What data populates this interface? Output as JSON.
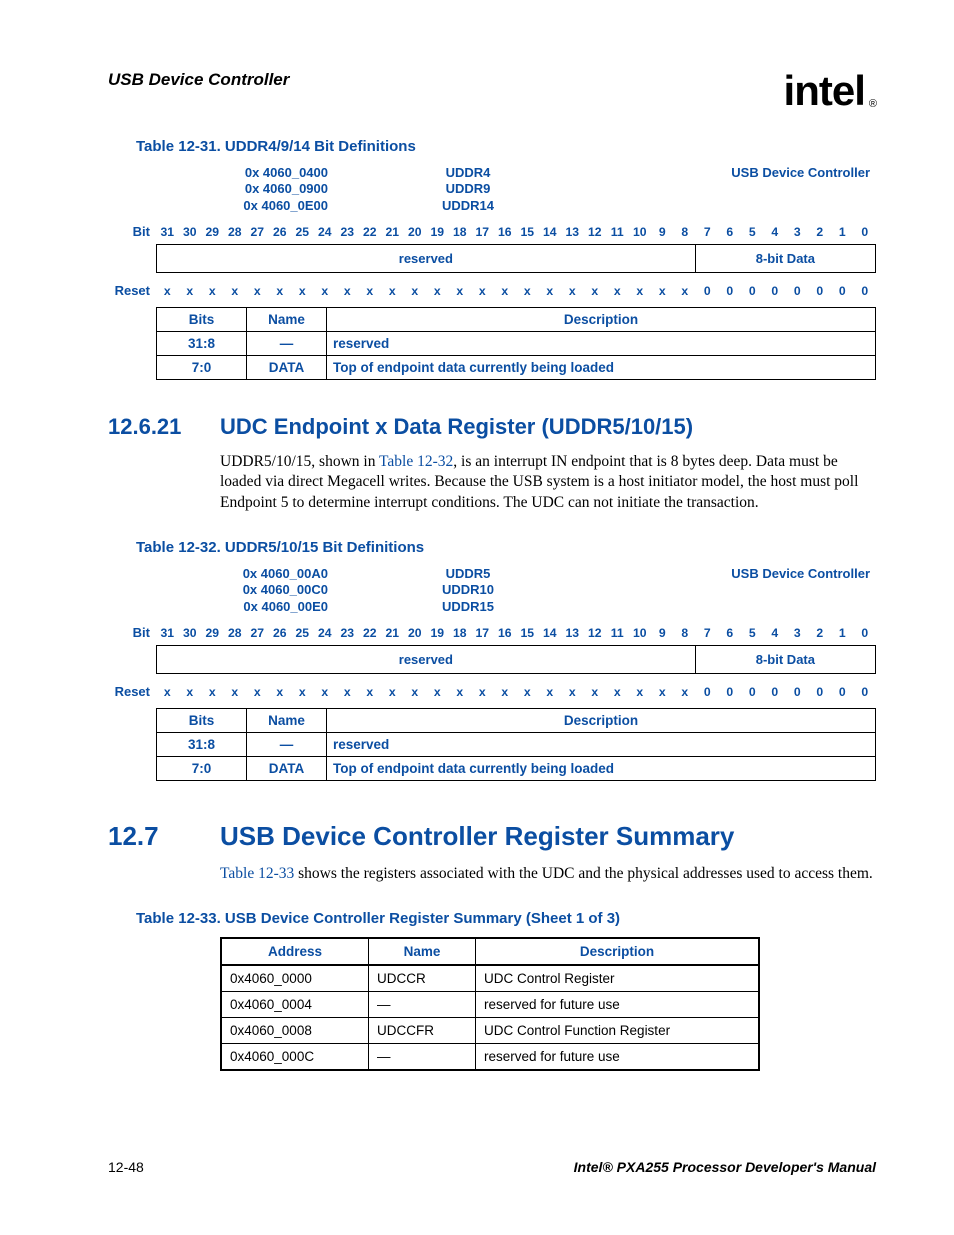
{
  "header": {
    "title": "USB Device Controller",
    "logo": "intel",
    "reg": "®"
  },
  "table31": {
    "caption": "Table 12-31. UDDR4/9/14 Bit Definitions",
    "addresses": [
      "0x 4060_0400",
      "0x 4060_0900",
      "0x 4060_0E00"
    ],
    "reg_names": [
      "UDDR4",
      "UDDR9",
      "UDDR14"
    ],
    "device": "USB Device Controller",
    "bit_label": "Bit",
    "reset_label": "Reset",
    "fields": [
      {
        "label": "reserved",
        "span": 24
      },
      {
        "label": "8-bit Data",
        "span": 8
      }
    ],
    "reset_vals": [
      "x",
      "x",
      "x",
      "x",
      "x",
      "x",
      "x",
      "x",
      "x",
      "x",
      "x",
      "x",
      "x",
      "x",
      "x",
      "x",
      "x",
      "x",
      "x",
      "x",
      "x",
      "x",
      "x",
      "x",
      "0",
      "0",
      "0",
      "0",
      "0",
      "0",
      "0",
      "0"
    ],
    "defs_head": {
      "bits": "Bits",
      "name": "Name",
      "desc": "Description"
    },
    "defs": [
      {
        "bits": "31:8",
        "name": "—",
        "desc": "reserved"
      },
      {
        "bits": "7:0",
        "name": "DATA",
        "desc": "Top of endpoint data currently being loaded"
      }
    ]
  },
  "section21": {
    "num": "12.6.21",
    "title": "UDC Endpoint x Data Register (UDDR5/10/15)",
    "para_pre": "UDDR5/10/15, shown in ",
    "para_link": "Table 12-32",
    "para_post": ", is an interrupt IN endpoint that is 8 bytes deep. Data must be loaded via direct Megacell writes. Because the USB system is a host initiator model, the host must poll Endpoint 5 to determine interrupt conditions. The UDC can not initiate the transaction."
  },
  "table32": {
    "caption": "Table 12-32. UDDR5/10/15 Bit Definitions",
    "addresses": [
      "0x 4060_00A0",
      "0x 4060_00C0",
      "0x 4060_00E0"
    ],
    "reg_names": [
      "UDDR5",
      "UDDR10",
      "UDDR15"
    ],
    "device": "USB Device Controller",
    "bit_label": "Bit",
    "reset_label": "Reset",
    "fields": [
      {
        "label": "reserved",
        "span": 24
      },
      {
        "label": "8-bit Data",
        "span": 8
      }
    ],
    "reset_vals": [
      "x",
      "x",
      "x",
      "x",
      "x",
      "x",
      "x",
      "x",
      "x",
      "x",
      "x",
      "x",
      "x",
      "x",
      "x",
      "x",
      "x",
      "x",
      "x",
      "x",
      "x",
      "x",
      "x",
      "x",
      "0",
      "0",
      "0",
      "0",
      "0",
      "0",
      "0",
      "0"
    ],
    "defs_head": {
      "bits": "Bits",
      "name": "Name",
      "desc": "Description"
    },
    "defs": [
      {
        "bits": "31:8",
        "name": "—",
        "desc": "reserved"
      },
      {
        "bits": "7:0",
        "name": "DATA",
        "desc": "Top of endpoint data currently being loaded"
      }
    ]
  },
  "section7": {
    "num": "12.7",
    "title": "USB Device Controller Register Summary",
    "para_link": "Table 12-33",
    "para_post": " shows the registers associated with the UDC and the physical addresses used to access them."
  },
  "table33": {
    "caption": "Table 12-33. USB Device Controller Register Summary (Sheet 1 of 3)",
    "head": {
      "addr": "Address",
      "name": "Name",
      "desc": "Description"
    },
    "rows": [
      {
        "addr": "0x4060_0000",
        "name": "UDCCR",
        "desc": "UDC Control Register"
      },
      {
        "addr": "0x4060_0004",
        "name": "—",
        "desc": "reserved for future use"
      },
      {
        "addr": "0x4060_0008",
        "name": "UDCCFR",
        "desc": "UDC Control Function Register"
      },
      {
        "addr": "0x4060_000C",
        "name": "—",
        "desc": "reserved for future use"
      }
    ]
  },
  "footer": {
    "page": "12-48",
    "manual": "Intel® PXA255 Processor Developer's Manual"
  },
  "bit_numbers": [
    "31",
    "30",
    "29",
    "28",
    "27",
    "26",
    "25",
    "24",
    "23",
    "22",
    "21",
    "20",
    "19",
    "18",
    "17",
    "16",
    "15",
    "14",
    "13",
    "12",
    "11",
    "10",
    "9",
    "8",
    "7",
    "6",
    "5",
    "4",
    "3",
    "2",
    "1",
    "0"
  ]
}
